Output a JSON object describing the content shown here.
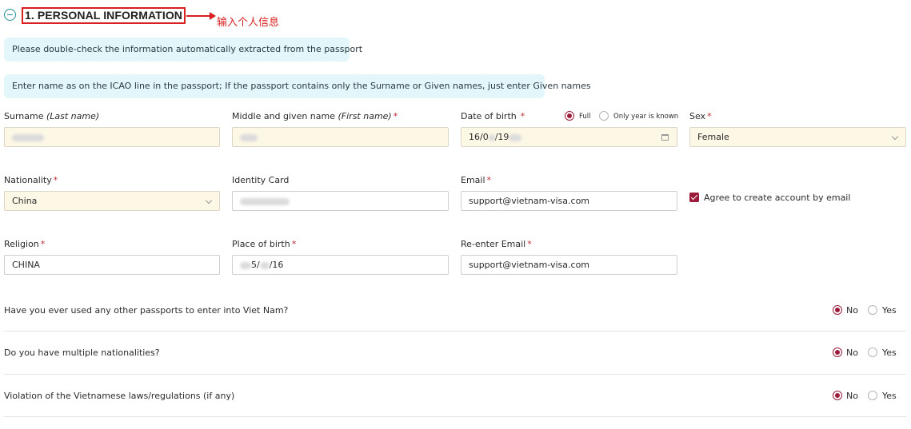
{
  "section": {
    "title": "1. PERSONAL INFORMATION",
    "annotation": "输入个人信息"
  },
  "notices": [
    "Please double-check the information automatically extracted from the passport",
    "Enter name as on the ICAO line in the passport; If the passport contains only the Surname or Given names, just enter Given names"
  ],
  "fields": {
    "surname": {
      "label": "Surname ",
      "label_italic": "(Last name)"
    },
    "given_name": {
      "label": "Middle and given name ",
      "label_italic": "(First name)"
    },
    "dob": {
      "label": "Date of birth",
      "value_a": "16/0",
      "value_b": "/19",
      "option_full": "Full",
      "option_year": "Only year is known"
    },
    "sex": {
      "label": "Sex",
      "value": "Female"
    },
    "nationality": {
      "label": "Nationality",
      "value": "China"
    },
    "identity_card": {
      "label": "Identity Card"
    },
    "email": {
      "label": "Email",
      "value": "support@vietnam-visa.com"
    },
    "agree": {
      "label": "Agree to create account by email"
    },
    "religion": {
      "label": "Religion",
      "value": "CHINA"
    },
    "place_of_birth": {
      "label": "Place of birth",
      "value_a": "5/",
      "value_b": "/16"
    },
    "reenter_email": {
      "label": "Re-enter Email",
      "value": "support@vietnam-visa.com"
    }
  },
  "required_mark": "*",
  "questions": [
    {
      "text": "Have you ever used any other passports to enter into Viet Nam?",
      "no": "No",
      "yes": "Yes",
      "selected": "No"
    },
    {
      "text": "Do you have multiple nationalities?",
      "no": "No",
      "yes": "Yes",
      "selected": "No"
    },
    {
      "text": "Violation of the Vietnamese laws/regulations (if any)",
      "no": "No",
      "yes": "Yes",
      "selected": "No"
    }
  ],
  "colors": {
    "accent": "#9b1c3a",
    "annotation_red": "#d81f1f",
    "notice_bg": "#e3f6fa",
    "prefilled_bg": "#fdf7e6"
  }
}
